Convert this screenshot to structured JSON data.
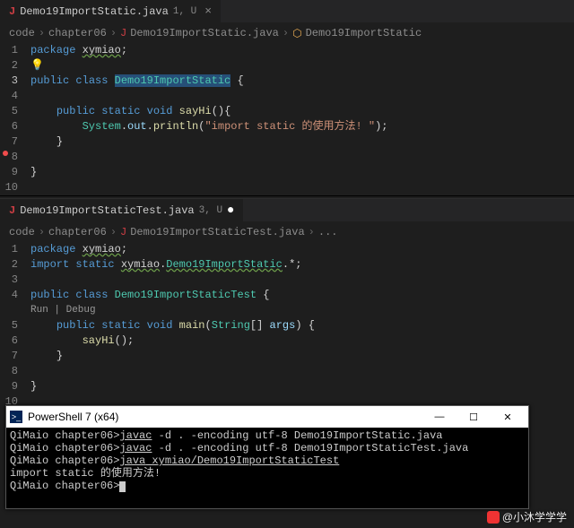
{
  "editor1": {
    "tab": {
      "filename": "Demo19ImportStatic.java",
      "status": "1, U"
    },
    "breadcrumb": {
      "p1": "code",
      "p2": "chapter06",
      "p3": "Demo19ImportStatic.java",
      "p4": "Demo19ImportStatic"
    },
    "lines": {
      "l1": {
        "n": "1",
        "kw": "package",
        "pkg": "xymiao",
        "semi": ";"
      },
      "l2": {
        "n": "2"
      },
      "l3": {
        "n": "3",
        "kw1": "public",
        "kw2": "class",
        "cls": "Demo19ImportStatic",
        "brace": "{"
      },
      "l4": {
        "n": "4"
      },
      "l5": {
        "n": "5",
        "kw1": "public",
        "kw2": "static",
        "kw3": "void",
        "fn": "sayHi",
        "paren": "(){"
      },
      "l6": {
        "n": "6",
        "obj": "System",
        "out": "out",
        "m": "println",
        "str": "\"import static 的使用方法! \"",
        "end": ");"
      },
      "l7": {
        "n": "7",
        "brace": "}"
      },
      "l8": {
        "n": "8"
      },
      "l9": {
        "n": "9",
        "brace": "}"
      },
      "l10": {
        "n": "10"
      }
    }
  },
  "editor2": {
    "tab": {
      "filename": "Demo19ImportStaticTest.java",
      "status": "3, U"
    },
    "breadcrumb": {
      "p1": "code",
      "p2": "chapter06",
      "p3": "Demo19ImportStaticTest.java",
      "p4": "..."
    },
    "codelens": "Run | Debug",
    "lines": {
      "l1": {
        "n": "1",
        "kw": "package",
        "pkg": "xymiao",
        "semi": ";"
      },
      "l2": {
        "n": "2",
        "kw1": "import",
        "kw2": "static",
        "pkg": "xymiao",
        "cls": "Demo19ImportStatic",
        "tail": ".*;"
      },
      "l3": {
        "n": "3"
      },
      "l4": {
        "n": "4",
        "kw1": "public",
        "kw2": "class",
        "cls": "Demo19ImportStaticTest",
        "brace": "{"
      },
      "l5": {
        "n": "5",
        "kw1": "public",
        "kw2": "static",
        "kw3": "void",
        "fn": "main",
        "argT": "String",
        "argN": "args",
        "brace": ") {"
      },
      "l6": {
        "n": "6",
        "fn": "sayHi",
        "end": "();"
      },
      "l7": {
        "n": "7",
        "brace": "}"
      },
      "l8": {
        "n": "8"
      },
      "l9": {
        "n": "9",
        "brace": "}"
      },
      "l10": {
        "n": "10"
      }
    }
  },
  "powershell": {
    "title": "PowerShell 7 (x64)",
    "lines": {
      "l1a": "QiMaio chapter06>",
      "l1b": "javac",
      "l1c": " -d . -encoding utf-8 Demo19ImportStatic.java",
      "l2a": "QiMaio chapter06>",
      "l2b": "javac",
      "l2c": " -d . -encoding utf-8 Demo19ImportStaticTest.java",
      "l3a": "QiMaio chapter06>",
      "l3b": "java",
      "l3c": " xymiao/Demo19ImportStaticTest",
      "l4": "import static 的使用方法!",
      "l5": "QiMaio chapter06>"
    }
  },
  "watermark": {
    "text": "@小沐学学学"
  }
}
